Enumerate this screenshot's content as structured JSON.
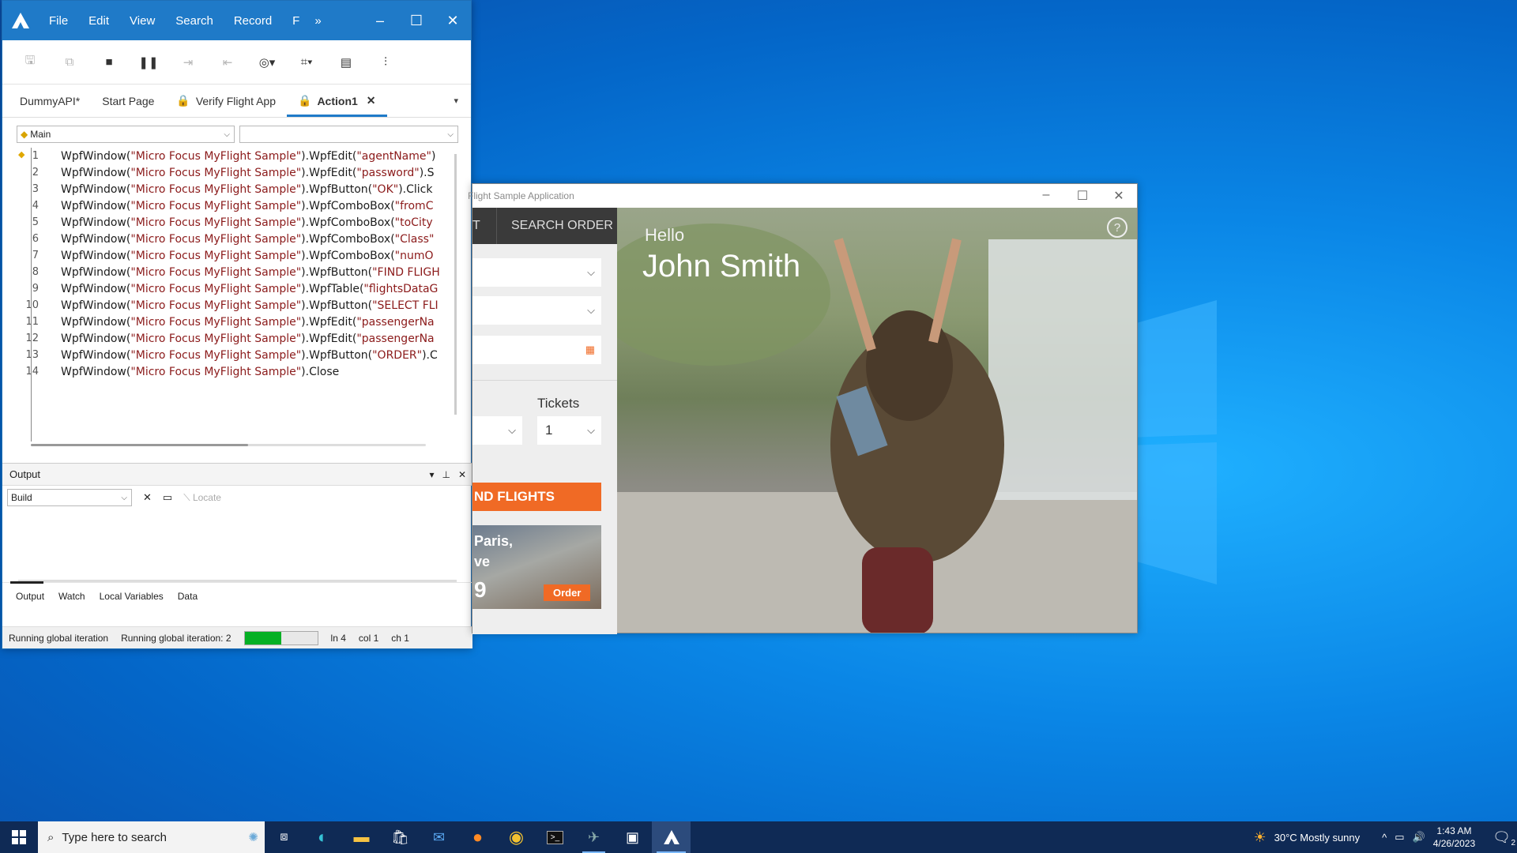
{
  "uft": {
    "menu": [
      "File",
      "Edit",
      "View",
      "Search",
      "Record",
      "F"
    ],
    "tabs": [
      {
        "label": "DummyAPI*",
        "locked": false
      },
      {
        "label": "Start Page",
        "locked": false
      },
      {
        "label": "Verify Flight App",
        "locked": true
      },
      {
        "label": "Action1",
        "locked": true
      }
    ],
    "combo_left": "Main",
    "combo_right": "",
    "code_lines": [
      {
        "n": "1",
        "pre": "WpfWindow(",
        "s1": "\"Micro Focus MyFlight Sample\"",
        "mid": ").WpfEdit(",
        "s2": "\"agentName\"",
        "post": ")"
      },
      {
        "n": "2",
        "pre": "WpfWindow(",
        "s1": "\"Micro Focus MyFlight Sample\"",
        "mid": ").WpfEdit(",
        "s2": "\"password\"",
        "post": ").S"
      },
      {
        "n": "3",
        "pre": "WpfWindow(",
        "s1": "\"Micro Focus MyFlight Sample\"",
        "mid": ").WpfButton(",
        "s2": "\"OK\"",
        "post": ").Click"
      },
      {
        "n": "4",
        "pre": "WpfWindow(",
        "s1": "\"Micro Focus MyFlight Sample\"",
        "mid": ").WpfComboBox(",
        "s2": "\"fromC",
        "post": ""
      },
      {
        "n": "5",
        "pre": "WpfWindow(",
        "s1": "\"Micro Focus MyFlight Sample\"",
        "mid": ").WpfComboBox(",
        "s2": "\"toCity",
        "post": ""
      },
      {
        "n": "6",
        "pre": "WpfWindow(",
        "s1": "\"Micro Focus MyFlight Sample\"",
        "mid": ").WpfComboBox(",
        "s2": "\"Class\"",
        "post": ""
      },
      {
        "n": "7",
        "pre": "WpfWindow(",
        "s1": "\"Micro Focus MyFlight Sample\"",
        "mid": ").WpfComboBox(",
        "s2": "\"numO",
        "post": ""
      },
      {
        "n": "8",
        "pre": "WpfWindow(",
        "s1": "\"Micro Focus MyFlight Sample\"",
        "mid": ").WpfButton(",
        "s2": "\"FIND FLIGH",
        "post": ""
      },
      {
        "n": "9",
        "pre": "WpfWindow(",
        "s1": "\"Micro Focus MyFlight Sample\"",
        "mid": ").WpfTable(",
        "s2": "\"flightsDataG",
        "post": ""
      },
      {
        "n": "10",
        "pre": "WpfWindow(",
        "s1": "\"Micro Focus MyFlight Sample\"",
        "mid": ").WpfButton(",
        "s2": "\"SELECT FLI",
        "post": ""
      },
      {
        "n": "11",
        "pre": "WpfWindow(",
        "s1": "\"Micro Focus MyFlight Sample\"",
        "mid": ").WpfEdit(",
        "s2": "\"passengerNa",
        "post": ""
      },
      {
        "n": "12",
        "pre": "WpfWindow(",
        "s1": "\"Micro Focus MyFlight Sample\"",
        "mid": ").WpfEdit(",
        "s2": "\"passengerNa",
        "post": ""
      },
      {
        "n": "13",
        "pre": "WpfWindow(",
        "s1": "\"Micro Focus MyFlight Sample\"",
        "mid": ").WpfButton(",
        "s2": "\"ORDER\"",
        "post": ").C"
      },
      {
        "n": "14",
        "pre": "WpfWindow(",
        "s1": "\"Micro Focus MyFlight Sample\"",
        "mid": ").Close",
        "s2": "",
        "post": ""
      }
    ],
    "output": {
      "title": "Output",
      "combo_value": "Build",
      "locate_label": "Locate",
      "bottom_tabs": [
        "Output",
        "Watch",
        "Local Variables",
        "Data"
      ]
    },
    "status": {
      "left": "Running global iteration",
      "iteration": "Running global iteration: 2",
      "progress": 0.5,
      "line": "ln 4",
      "col": "col 1",
      "ch": "ch 1"
    }
  },
  "flight": {
    "title": "Flight Sample Application",
    "nav_partial": "T",
    "nav_search_order": "SEARCH ORDER",
    "tickets_label": "Tickets",
    "tickets_value": "1",
    "find_button": "ND FLIGHTS",
    "promo_line1": "Paris,",
    "promo_line2": "ve",
    "promo_price": "9",
    "promo_order": "Order",
    "hello": "Hello",
    "user_name": "John Smith",
    "help": "?"
  },
  "taskbar": {
    "search_placeholder": "Type here to search",
    "weather": "30°C  Mostly sunny",
    "time": "1:43 AM",
    "date": "4/26/2023",
    "notification_count": "2"
  },
  "colors": {
    "accent": "#1f7ac8",
    "orange": "#f06a25",
    "string": "#8b1a1a",
    "progress": "#06b025"
  }
}
